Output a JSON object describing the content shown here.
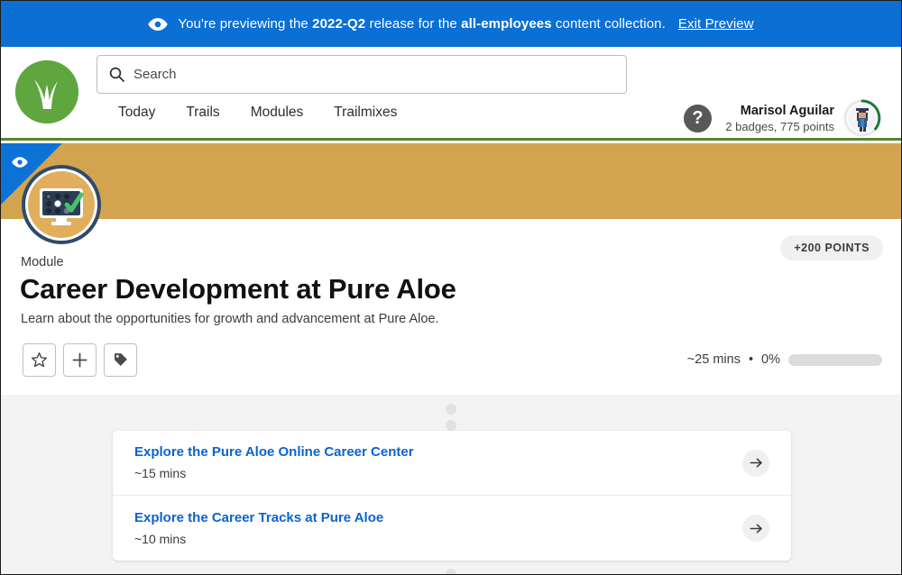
{
  "preview_banner": {
    "icon": "eye-icon",
    "text_before": "You're previewing the ",
    "release": "2022-Q2",
    "text_middle": " release for the ",
    "collection": "all-employees",
    "text_after": " content collection.",
    "exit_label": "Exit Preview",
    "background_color": "#0B6FD4"
  },
  "header": {
    "logo_name": "trailhead-logo",
    "search": {
      "placeholder": "Search",
      "value": "",
      "icon": "search-icon"
    },
    "nav": [
      {
        "label": "Today"
      },
      {
        "label": "Trails"
      },
      {
        "label": "Modules"
      },
      {
        "label": "Trailmixes"
      }
    ],
    "help_icon_label": "?",
    "user": {
      "name": "Marisol Aguilar",
      "stats": "2 badges, 775 points",
      "avatar_name": "user-avatar",
      "ring_color": "#1C7A3E"
    },
    "accent_underline_color": "#5A8727"
  },
  "hero": {
    "background_color": "#D2A450",
    "ribbon_color": "#0D72D6",
    "ribbon_icon": "eye-icon"
  },
  "module": {
    "badge_icon_name": "module-computer-check-icon",
    "kicker": "Module",
    "title": "Career Development at Pure Aloe",
    "description": "Learn about the opportunities for growth and advancement at Pure Aloe.",
    "points_badge": "+200 POINTS",
    "actions": [
      {
        "name": "favorite-button",
        "icon": "star-icon"
      },
      {
        "name": "add-to-trailmix-button",
        "icon": "plus-icon"
      },
      {
        "name": "tag-button",
        "icon": "tag-icon"
      }
    ],
    "duration": "~25 mins",
    "separator": "•",
    "progress_percent_label": "0%",
    "progress_percent_value": 0,
    "progress_bar_color": "#4BA64B",
    "progress_track_color": "#dcdcdc"
  },
  "units": [
    {
      "title": "Explore the Pure Aloe Online Career Center",
      "duration": "~15 mins",
      "arrow_icon": "arrow-right-icon"
    },
    {
      "title": "Explore the Career Tracks at Pure Aloe",
      "duration": "~10 mins",
      "arrow_icon": "arrow-right-icon"
    }
  ]
}
